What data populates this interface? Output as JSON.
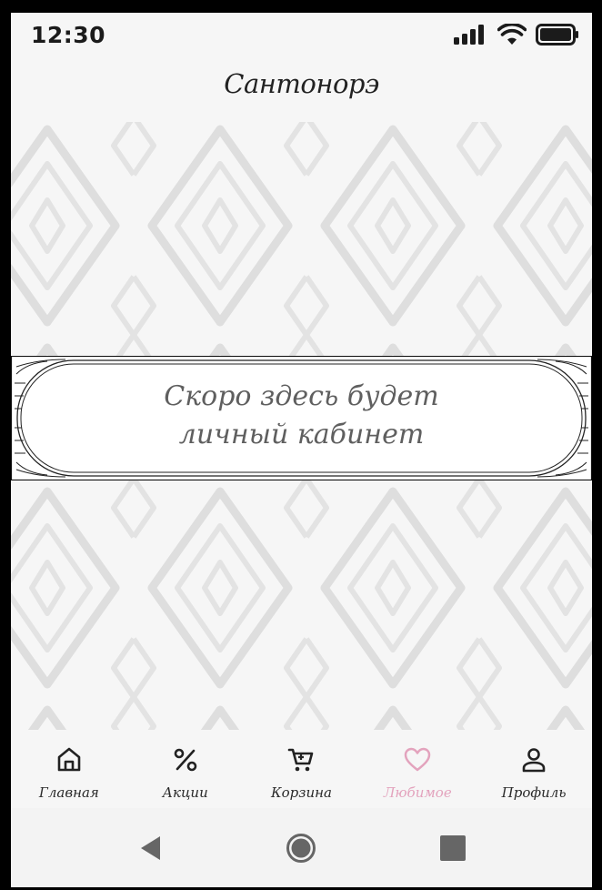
{
  "status_bar": {
    "time": "12:30"
  },
  "logo": {
    "text": "Сантонорэ"
  },
  "banner": {
    "line1": "Скоро здесь будет",
    "line2": "личный кабинет"
  },
  "bottom_nav": {
    "items": [
      {
        "label": "Главная",
        "icon": "home-icon"
      },
      {
        "label": "Акции",
        "icon": "percent-icon"
      },
      {
        "label": "Корзина",
        "icon": "cart-icon"
      },
      {
        "label": "Любимое",
        "icon": "heart-icon",
        "active": true
      },
      {
        "label": "Профиль",
        "icon": "person-icon"
      }
    ]
  },
  "system_nav": {
    "back": "back-icon",
    "home": "home-circle-icon",
    "recents": "recents-icon"
  },
  "colors": {
    "active": "#e3a3bd",
    "banner_text": "#5f5f5f",
    "pattern": "#dedede"
  }
}
